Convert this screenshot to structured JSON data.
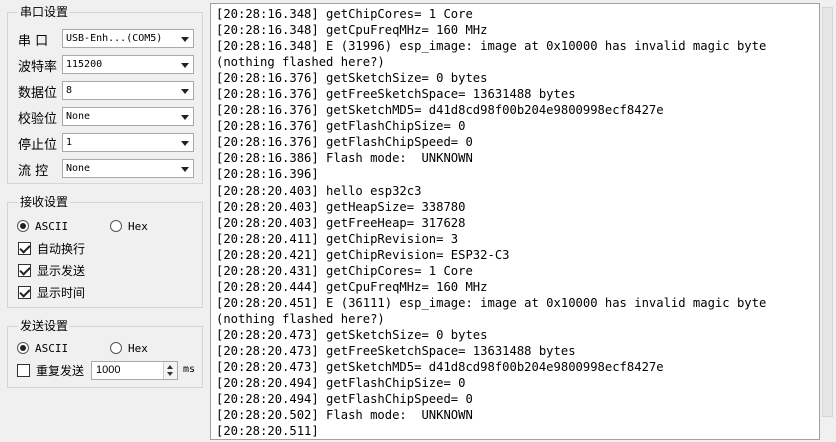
{
  "serial_settings": {
    "title": "串口设置",
    "port": {
      "label": "串 口",
      "value": "USB-Enh...(COM5)"
    },
    "baud": {
      "label": "波特率",
      "value": "115200"
    },
    "data_bits": {
      "label": "数据位",
      "value": "8"
    },
    "parity": {
      "label": "校验位",
      "value": "None"
    },
    "stop_bits": {
      "label": "停止位",
      "value": "1"
    },
    "flow": {
      "label": "流 控",
      "value": "None"
    }
  },
  "receive_settings": {
    "title": "接收设置",
    "ascii_label": "ASCII",
    "hex_label": "Hex",
    "selected": "ASCII",
    "auto_wrap": {
      "label": "自动换行",
      "checked": true
    },
    "show_send": {
      "label": "显示发送",
      "checked": true
    },
    "show_time": {
      "label": "显示时间",
      "checked": true
    }
  },
  "send_settings": {
    "title": "发送设置",
    "ascii_label": "ASCII",
    "hex_label": "Hex",
    "selected": "ASCII",
    "repeat": {
      "label": "重复发送",
      "checked": false
    },
    "interval_value": "1000",
    "interval_unit": "ms"
  },
  "log": {
    "lines": [
      "[20:28:16.348] getChipCores= 1 Core",
      "[20:28:16.348] getCpuFreqMHz= 160 MHz",
      "[20:28:16.348] E (31996) esp_image: image at 0x10000 has invalid magic byte",
      "(nothing flashed here?)",
      "[20:28:16.376] getSketchSize= 0 bytes",
      "[20:28:16.376] getFreeSketchSpace= 13631488 bytes",
      "[20:28:16.376] getSketchMD5= d41d8cd98f00b204e9800998ecf8427e",
      "[20:28:16.376] getFlashChipSize= 0",
      "[20:28:16.376] getFlashChipSpeed= 0",
      "[20:28:16.386] Flash mode:  UNKNOWN",
      "[20:28:16.396]",
      "[20:28:20.403] hello esp32c3",
      "[20:28:20.403] getHeapSize= 338780",
      "[20:28:20.403] getFreeHeap= 317628",
      "[20:28:20.411] getChipRevision= 3",
      "[20:28:20.421] getChipRevision= ESP32-C3",
      "[20:28:20.431] getChipCores= 1 Core",
      "[20:28:20.444] getCpuFreqMHz= 160 MHz",
      "[20:28:20.451] E (36111) esp_image: image at 0x10000 has invalid magic byte",
      "(nothing flashed here?)",
      "[20:28:20.473] getSketchSize= 0 bytes",
      "[20:28:20.473] getFreeSketchSpace= 13631488 bytes",
      "[20:28:20.473] getSketchMD5= d41d8cd98f00b204e9800998ecf8427e",
      "[20:28:20.494] getFlashChipSize= 0",
      "[20:28:20.494] getFlashChipSpeed= 0",
      "[20:28:20.502] Flash mode:  UNKNOWN",
      "[20:28:20.511]"
    ]
  }
}
